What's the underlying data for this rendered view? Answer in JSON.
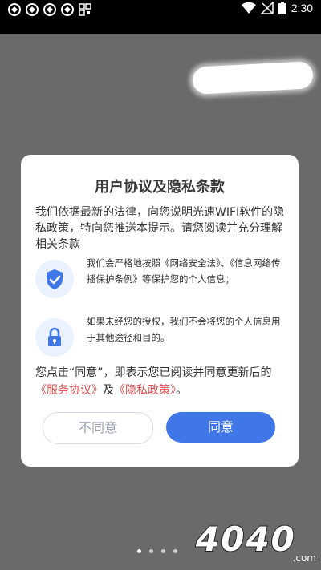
{
  "status_bar": {
    "time": "2:30",
    "icons": [
      "app-icon",
      "app-icon",
      "app-icon",
      "app-icon",
      "qr-icon",
      "wifi-icon",
      "signal-icon",
      "battery-icon"
    ]
  },
  "dialog": {
    "title": "用户协议及隐私条款",
    "intro": "我们依据最新的法律，向您说明光速WIFI软件的隐私政策，特向您推送本提示。请您阅读并充分理解相关条款",
    "items": [
      {
        "icon": "shield-check-icon",
        "text": "我们会严格地按照《网络安全法》、《信息网络传播保护条例》等保护您的个人信息；"
      },
      {
        "icon": "lock-icon",
        "text": "如果未经您的授权，我们不会将您的个人信息用于其他途径和目的。"
      }
    ],
    "footer": {
      "prefix": "您点击“同意”，即表示您已阅读并同意更新后的",
      "service_link": "《服务协议》",
      "and": "及",
      "privacy_link": "《隐私政策》",
      "suffix": "。"
    },
    "disagree_label": "不同意",
    "agree_label": "同意"
  },
  "pager": {
    "count": 4,
    "active_index": 0
  },
  "watermark": {
    "text": "4040",
    "suffix": ".com"
  },
  "colors": {
    "accent": "#3f76e8",
    "link": "#e04a4a",
    "overlay": "#6a6a6a"
  }
}
